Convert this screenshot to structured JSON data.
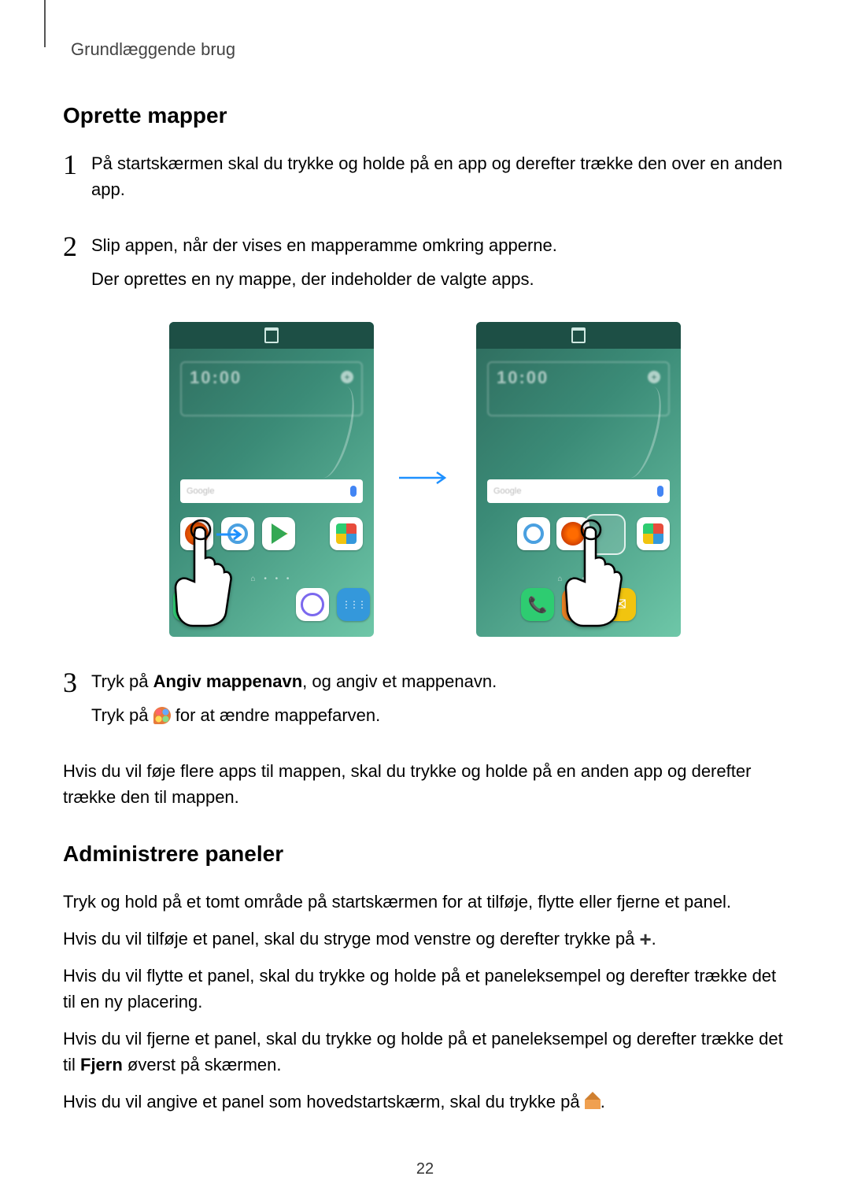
{
  "header": {
    "breadcrumb": "Grundlæggende brug"
  },
  "section1": {
    "title": "Oprette mapper",
    "step1": {
      "num": "1",
      "text": "På startskærmen skal du trykke og holde på en app og derefter trække den over en anden app."
    },
    "step2": {
      "num": "2",
      "line1": "Slip appen, når der vises en mapperamme omkring apperne.",
      "line2": "Der oprettes en ny mappe, der indeholder de valgte apps."
    },
    "step3": {
      "num": "3",
      "line1_pre": "Tryk på ",
      "line1_bold": "Angiv mappenavn",
      "line1_post": ", og angiv et mappenavn.",
      "line2_pre": "Tryk på ",
      "line2_post": " for at ændre mappefarven."
    },
    "after": "Hvis du vil føje flere apps til mappen, skal du trykke og holde på en anden app og derefter trække den til mappen."
  },
  "section2": {
    "title": "Administrere paneler",
    "p1": "Tryk og hold på et tomt område på startskærmen for at tilføje, flytte eller fjerne et panel.",
    "p2_pre": "Hvis du vil tilføje et panel, skal du stryge mod venstre og derefter trykke på ",
    "p2_post": ".",
    "p3": "Hvis du vil flytte et panel, skal du trykke og holde på et paneleksempel og derefter trække det til en ny placering.",
    "p4_pre": "Hvis du vil fjerne et panel, skal du trykke og holde på et paneleksempel og derefter trække det til ",
    "p4_bold": "Fjern",
    "p4_post": " øverst på skærmen.",
    "p5_pre": "Hvis du vil angive et panel som hovedstartskærm, skal du trykke på ",
    "p5_post": "."
  },
  "figure": {
    "search_placeholder": "Google",
    "time": "10:00"
  },
  "page_number": "22"
}
